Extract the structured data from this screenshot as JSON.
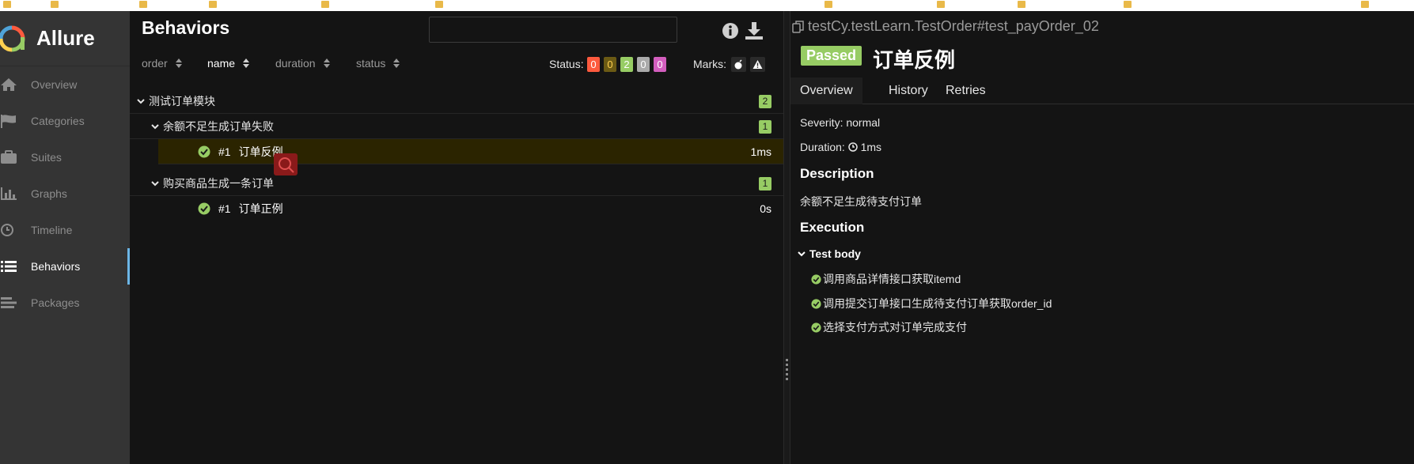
{
  "app": {
    "brand": "Allure",
    "colors": {
      "sidebar_bg": "#343434",
      "active_indicator": "#6cb6e6",
      "passed": "#97cc64",
      "failed": "#fd5a3e",
      "broken": "#ffd050",
      "skipped": "#aaaaaa",
      "unknown": "#d35ebe"
    }
  },
  "sidebar": {
    "items": [
      {
        "label": "Overview",
        "icon": "home-icon"
      },
      {
        "label": "Categories",
        "icon": "flag-icon"
      },
      {
        "label": "Suites",
        "icon": "briefcase-icon"
      },
      {
        "label": "Graphs",
        "icon": "bar-chart-icon"
      },
      {
        "label": "Timeline",
        "icon": "clock-icon"
      },
      {
        "label": "Behaviors",
        "icon": "list-icon",
        "active": true
      },
      {
        "label": "Packages",
        "icon": "align-left-icon"
      }
    ]
  },
  "behaviors": {
    "title": "Behaviors",
    "search": {
      "value": "",
      "placeholder": ""
    },
    "sort": {
      "order": "order",
      "name": "name",
      "duration": "duration",
      "status": "status"
    },
    "status_label": "Status:",
    "status_counts": {
      "failed": "0",
      "broken": "0",
      "passed": "2",
      "skipped": "0",
      "unknown": "0"
    },
    "marks_label": "Marks:",
    "tree": {
      "epic": {
        "label": "测试订单模块",
        "count": "2"
      },
      "features": [
        {
          "label": "余额不足生成订单失败",
          "count": "1",
          "tests": [
            {
              "num": "#1",
              "name": "订单反例",
              "duration": "1ms",
              "selected": true
            }
          ]
        },
        {
          "label": "购买商品生成一条订单",
          "count": "1",
          "tests": [
            {
              "num": "#1",
              "name": "订单正例",
              "duration": "0s"
            }
          ]
        }
      ]
    }
  },
  "detail": {
    "breadcrumb": "testCy.testLearn.TestOrder#test_payOrder_02",
    "status": "Passed",
    "title": "订单反例",
    "tabs": [
      "Overview",
      "History",
      "Retries"
    ],
    "severity_label": "Severity:",
    "severity": "normal",
    "duration_label": "Duration:",
    "duration": "1ms",
    "description_heading": "Description",
    "description": "余额不足生成待支付订单",
    "execution_heading": "Execution",
    "test_body": "Test body",
    "steps": [
      "调用商品详情接口获取itemd",
      "调用提交订单接口生成待支付订单获取order_id",
      "选择支付方式对订单完成支付"
    ]
  }
}
